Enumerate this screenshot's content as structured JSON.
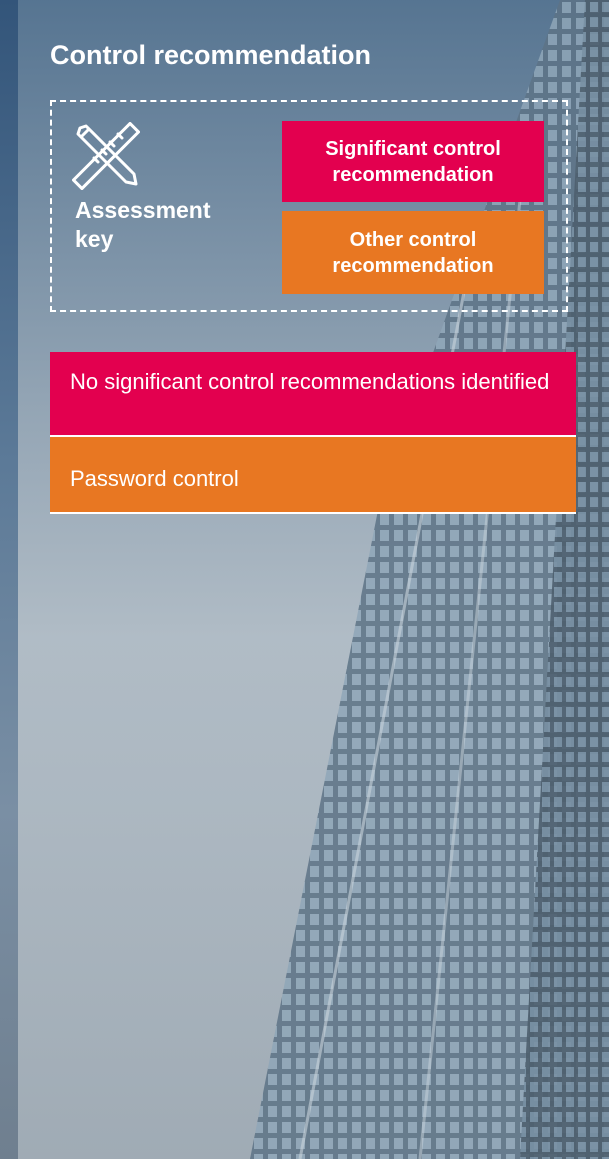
{
  "page": {
    "title": "Control recommendation"
  },
  "assessment_key": {
    "icon": "ruler-pencil-icon",
    "label": "Assessment key",
    "legend": [
      {
        "label": "Significant control recommendation",
        "color": "#e3004f"
      },
      {
        "label": "Other control recommendation",
        "color": "#e87722"
      }
    ]
  },
  "recommendations": [
    {
      "text": "No significant control recommendations identified",
      "color": "#e3004f"
    },
    {
      "text": "Password control",
      "color": "#e87722"
    }
  ]
}
